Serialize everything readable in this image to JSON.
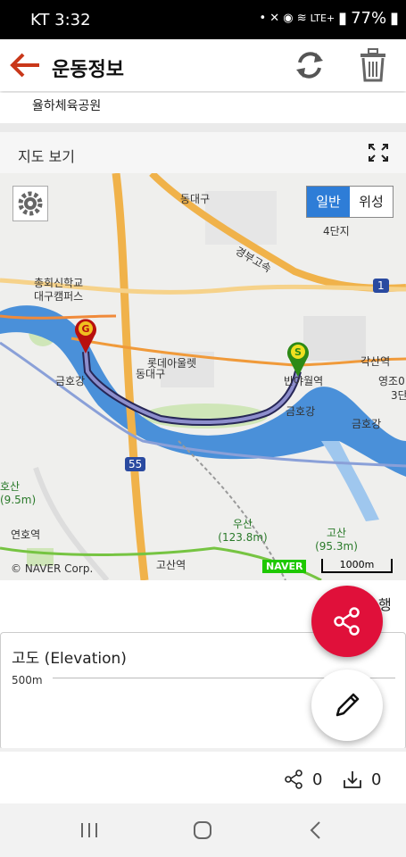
{
  "status": {
    "carrier_time": "KT 3:32",
    "network": "LTE+",
    "battery": "77%"
  },
  "appbar": {
    "title": "운동정보"
  },
  "place": {
    "name": "율하체육공원"
  },
  "map": {
    "header_label": "지도 보기",
    "toggle_general": "일반",
    "toggle_satellite": "위성",
    "copyright": "© NAVER Corp.",
    "naver_logo": "NAVER",
    "scale_label": "1000m",
    "labels": [
      "동대구",
      "동대구",
      "총회신학교 대구캠퍼스",
      "롯데아울렛",
      "금호강",
      "반야월역",
      "각산역",
      "영조0",
      "3단",
      "금호강",
      "금호강",
      "고산역",
      "우산 (123.8m)",
      "고산 (95.3m)",
      "연호역",
      "호산 (9.5m)",
      "4단지",
      "경부고속",
      "1",
      "55"
    ]
  },
  "below_map": {
    "partial_text": "행"
  },
  "elevation": {
    "title": "고도 (Elevation)",
    "y_tick": "500m"
  },
  "stats": {
    "share_count": "0",
    "download_count": "0"
  }
}
